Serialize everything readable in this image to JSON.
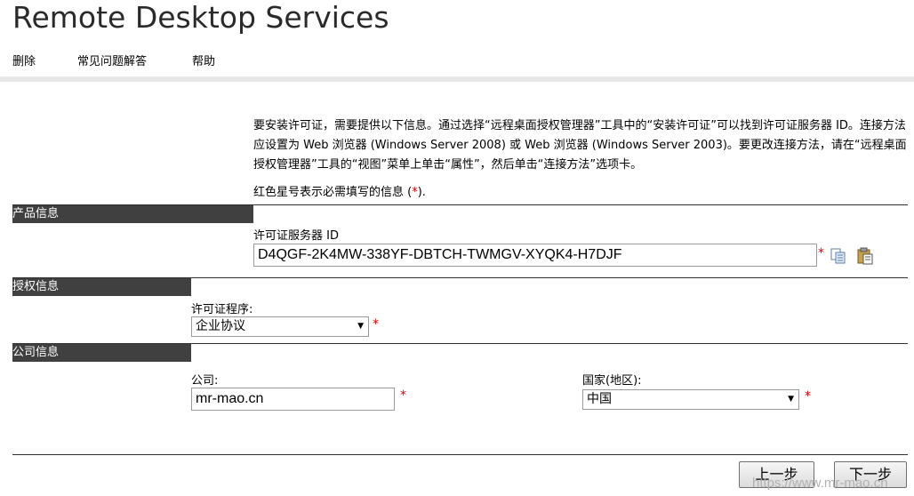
{
  "app": {
    "title": "Remote Desktop Services"
  },
  "nav": {
    "items": [
      "删除",
      "常见问题解答",
      "帮助"
    ]
  },
  "intro": {
    "text": "要安装许可证，需要提供以下信息。通过选择“远程桌面授权管理器”工具中的“安装许可证”可以找到许可证服务器 ID。连接方法应设置为 Web 浏览器 (Windows Server 2008) 或 Web 浏览器 (Windows Server 2003)。要更改连接方法，请在“远程桌面授权管理器”工具的“视图”菜单上单击“属性”，然后单击“连接方法”选项卡。",
    "required_note_prefix": "红色星号表示必需填写的信息 (",
    "required_note_star": "*",
    "required_note_suffix": ")."
  },
  "sections": {
    "product": {
      "title": "产品信息",
      "server_id_label": "许可证服务器 ID",
      "server_id_value": "D4QGF-2K4MW-338YF-DBTCH-TWMGV-XYQK4-H7DJF"
    },
    "licensing": {
      "title": "授权信息",
      "program_label": "许可证程序:",
      "program_value": "企业协议"
    },
    "company": {
      "title": "公司信息",
      "company_label": "公司:",
      "company_value": "mr-mao.cn",
      "country_label": "国家(地区):",
      "country_value": "中国"
    }
  },
  "required_star": "*",
  "buttons": {
    "back": "上一步",
    "next": "下一步"
  },
  "watermark": "https://www.mr-mao.cn",
  "colors": {
    "section_bg": "#404040",
    "required": "#dd0000"
  }
}
